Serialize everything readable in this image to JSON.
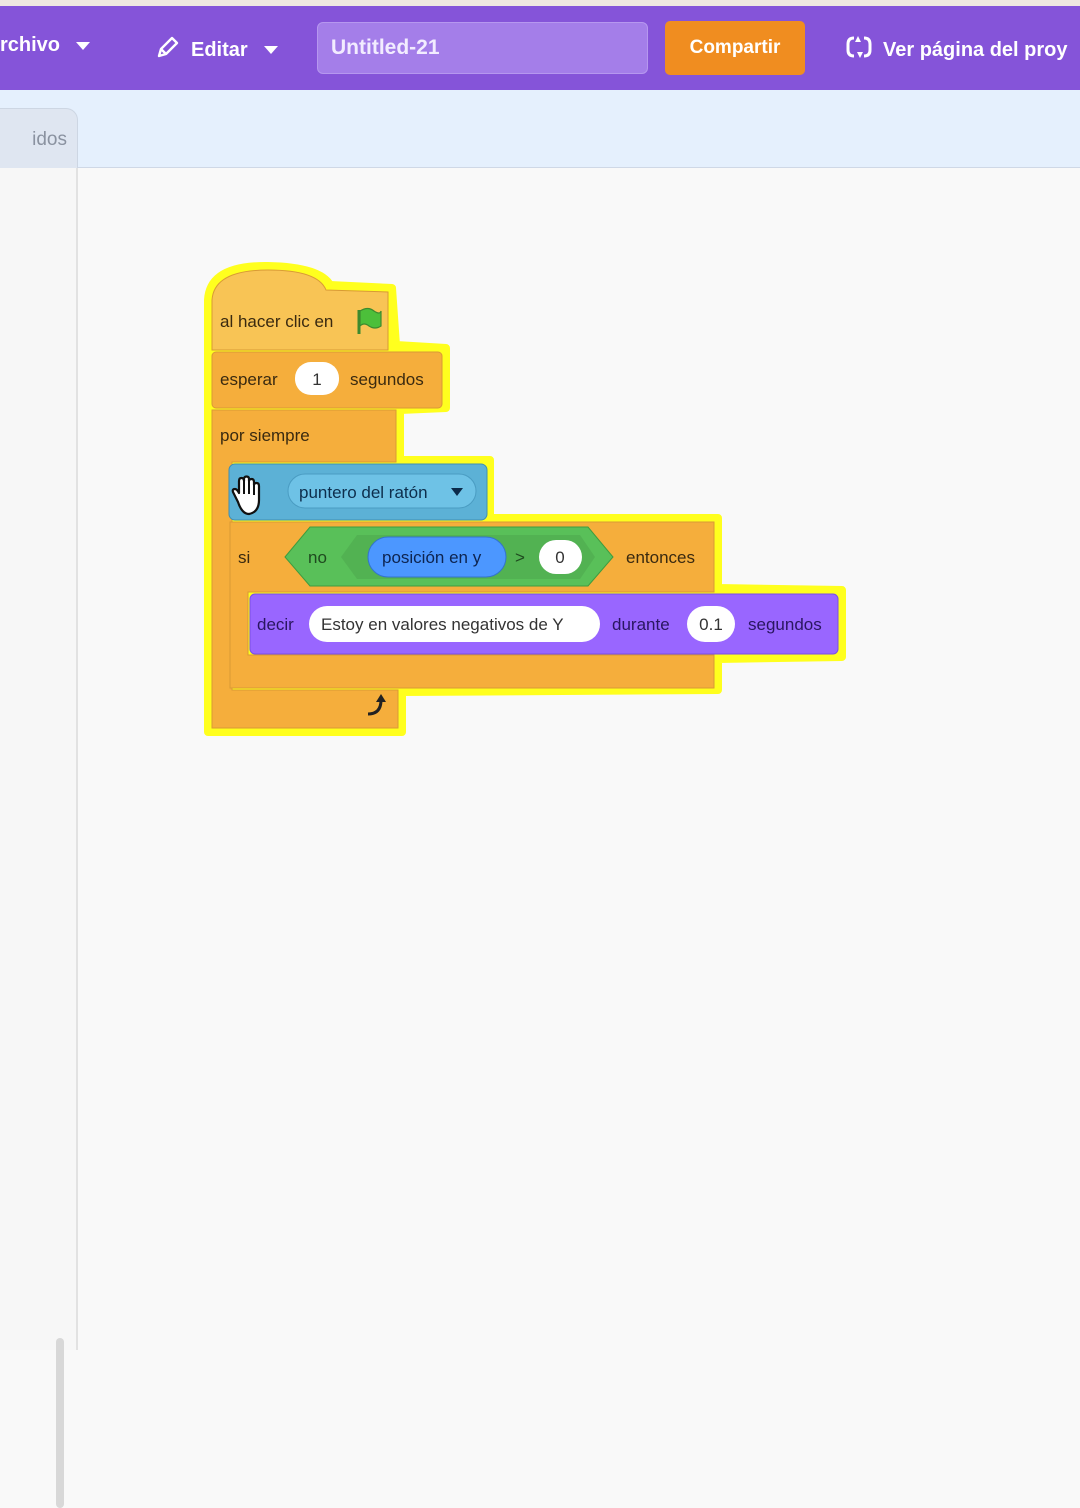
{
  "menubar": {
    "file_label": "rchivo",
    "edit_label": "Editar",
    "project_title": "Untitled-21",
    "share_label": "Compartir",
    "project_page_label": "Ver página del proy"
  },
  "tabs": {
    "code_tab_partial": "idos"
  },
  "script": {
    "hat_label": "al hacer clic en",
    "wait_label": "esperar",
    "wait_value": "1",
    "wait_unit": "segundos",
    "forever_label": "por siempre",
    "sensing_menu": "puntero del ratón",
    "if_label": "si",
    "not_label": "no",
    "y_position_label": "posición en y",
    "gt_symbol": ">",
    "compare_value": "0",
    "then_label": "entonces",
    "say_label": "decir",
    "say_text": "Estoy en valores negativos de Y",
    "during_label": "durante",
    "say_seconds": "0.1",
    "say_unit": "segundos"
  },
  "colors": {
    "menubar": "#8554d9",
    "share": "#f08d20",
    "control": "#f5ae3c",
    "sensing": "#5cb1d6",
    "operators": "#59c059",
    "looks": "#9966ff",
    "motion": "#4c97ff",
    "highlight": "#ffff1e"
  },
  "icons": [
    "pencil-icon",
    "remix-icon",
    "green-flag-icon",
    "hand-cursor-icon",
    "loop-arrow-icon"
  ]
}
